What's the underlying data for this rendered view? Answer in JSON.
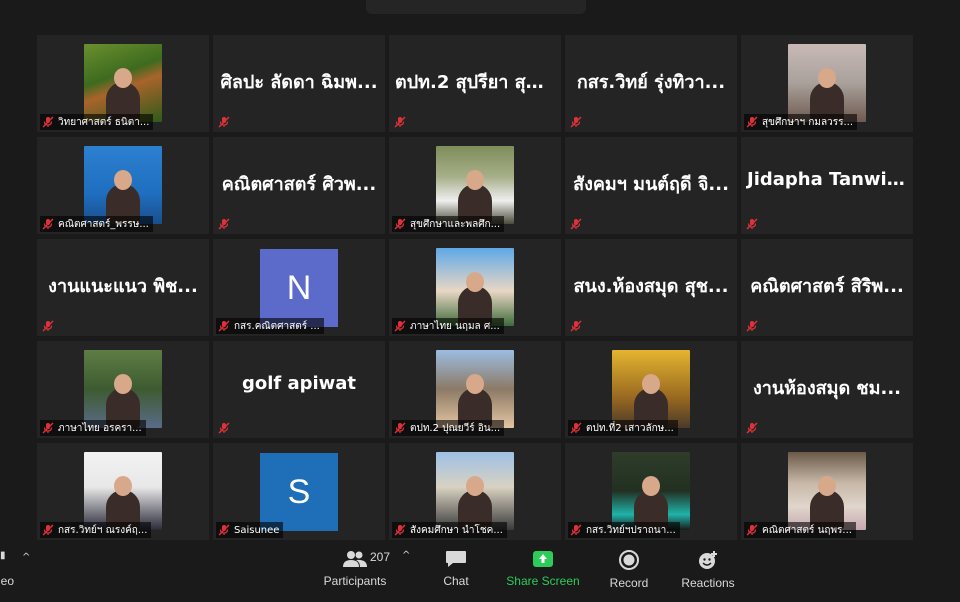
{
  "tiles": [
    {
      "type": "photo",
      "scene": "scene-forest",
      "label": "วิทยาศาสตร์ ธนิตา..."
    },
    {
      "type": "name",
      "display": "ศิลปะ ลัดดา ฉิมพ...",
      "label": ""
    },
    {
      "type": "name",
      "display": "ตปท.2 สุปรียา สุด...",
      "label": ""
    },
    {
      "type": "name",
      "display": "กสร.วิทย์ รุ่งทิวา...",
      "label": ""
    },
    {
      "type": "photo",
      "scene": "scene-blossom",
      "label": "สุขศึกษาฯ กมลวรร..."
    },
    {
      "type": "photo",
      "scene": "scene-suit",
      "label": "คณิตศาสตร์_พรรษ..."
    },
    {
      "type": "name",
      "display": "คณิตศาสตร์ ศิวพ...",
      "label": ""
    },
    {
      "type": "photo",
      "scene": "scene-chef",
      "label": "สุขศึกษาและพลศึก..."
    },
    {
      "type": "name",
      "display": "สังคมฯ มนต์ฤดี จิ...",
      "label": ""
    },
    {
      "type": "name",
      "display": "Jidapha  Tanwic...",
      "label": ""
    },
    {
      "type": "name",
      "display": "งานแนะแนว พิช...",
      "label": ""
    },
    {
      "type": "letter",
      "letter": "N",
      "bg": "bg-blue",
      "label": "กสร.คณิตศาสตร์ ..."
    },
    {
      "type": "photo",
      "scene": "scene-mountain",
      "label": "ภาษาไทย นฤมล ศ..."
    },
    {
      "type": "name",
      "display": "สนง.ห้องสมุด สุช...",
      "label": ""
    },
    {
      "type": "name",
      "display": "คณิตศาสตร์ สิริพ...",
      "label": ""
    },
    {
      "type": "photo",
      "scene": "scene-garden",
      "label": "ภาษาไทย อรครา..."
    },
    {
      "type": "name",
      "display": "golf apiwat",
      "label": ""
    },
    {
      "type": "photo",
      "scene": "scene-paris",
      "label": "ตปท.2 ปุณยวีร์ อิน..."
    },
    {
      "type": "photo",
      "scene": "scene-yellow",
      "label": "ตปท.ที่2 เสาวลักษ..."
    },
    {
      "type": "name",
      "display": "งานห้องสมุด ชม...",
      "label": ""
    },
    {
      "type": "photo",
      "scene": "scene-uniform",
      "label": "กสร.วิทย์ฯ ณรงค์ฤ..."
    },
    {
      "type": "letter",
      "letter": "S",
      "bg": "bg-darkblue",
      "label": "Saisunee"
    },
    {
      "type": "photo",
      "scene": "scene-castle",
      "label": "สังคมศึกษา นำโชค..."
    },
    {
      "type": "photo",
      "scene": "scene-mask",
      "label": "กสร.วิทย์ฯปราถนา..."
    },
    {
      "type": "photo",
      "scene": "scene-shrine",
      "label": "คณิตศาสตร์ นฤพร..."
    }
  ],
  "toolbar": {
    "video_label": "deo",
    "participants_label": "Participants",
    "participants_count": "207",
    "chat_label": "Chat",
    "share_label": "Share Screen",
    "record_label": "Record",
    "reactions_label": "Reactions"
  },
  "colors": {
    "background": "#1a1a1a",
    "tile": "#242424",
    "share_green": "#2dcc5a",
    "muted_red": "#e0313b"
  }
}
